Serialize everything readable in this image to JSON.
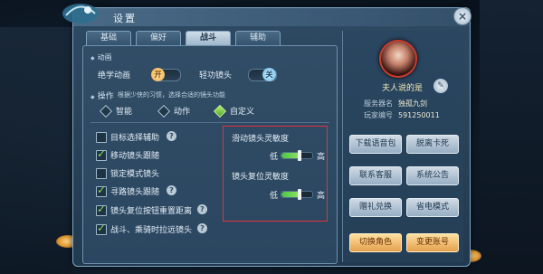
{
  "window": {
    "title": "设置",
    "close_label": "×"
  },
  "tabs": [
    {
      "label": "基础",
      "active": false
    },
    {
      "label": "偏好",
      "active": false
    },
    {
      "label": "战斗",
      "active": true
    },
    {
      "label": "辅助",
      "active": false
    }
  ],
  "animation": {
    "section_label": "动画",
    "unique_anim_label": "绝学动画",
    "unique_anim_toggle": "开",
    "light_cam_label": "轻功镜头",
    "light_cam_toggle": "关"
  },
  "operation": {
    "section_label": "操作",
    "hint": "根据少侠的习惯，选择合适的镜头功能",
    "options": [
      {
        "label": "智能",
        "checked": false
      },
      {
        "label": "动作",
        "checked": false
      },
      {
        "label": "自定义",
        "checked": true
      }
    ]
  },
  "checkboxes": [
    {
      "label": "目标选择辅助",
      "checked": false,
      "help": "?"
    },
    {
      "label": "移动镜头跟随",
      "checked": true
    },
    {
      "label": "锁定模式镜头",
      "checked": false
    },
    {
      "label": "寻路镜头跟随",
      "checked": true,
      "help": "?"
    },
    {
      "label": "镜头复位按钮重置距离",
      "checked": true,
      "help": "?"
    },
    {
      "label": "战斗、乘骑时拉远镜头",
      "checked": true,
      "help": "?"
    }
  ],
  "sliders": [
    {
      "label": "滑动镜头灵敏度",
      "low": "低",
      "high": "高",
      "value": 0.6
    },
    {
      "label": "镜头复位灵敏度",
      "low": "低",
      "high": "高",
      "value": 0.6
    }
  ],
  "profile": {
    "player_name": "夫人说的是",
    "edit_icon": "pen-icon",
    "server_key": "服务器名",
    "server_val": "独孤九剑",
    "player_id_key": "玩家编号",
    "player_id_val": "591250011"
  },
  "actions": [
    {
      "label": "下载语音包",
      "style": "blue"
    },
    {
      "label": "脱离卡死",
      "style": "blue"
    },
    {
      "label": "联系客服",
      "style": "blue"
    },
    {
      "label": "系统公告",
      "style": "blue"
    },
    {
      "label": "赠礼兑换",
      "style": "blue"
    },
    {
      "label": "省电模式",
      "style": "blue"
    },
    {
      "label": "切换角色",
      "style": "orange"
    },
    {
      "label": "变更账号",
      "style": "orange"
    }
  ],
  "colors": {
    "accent_green": "#86e04a",
    "highlight_red": "#e0343c",
    "orange_button": "#e3a04c"
  }
}
